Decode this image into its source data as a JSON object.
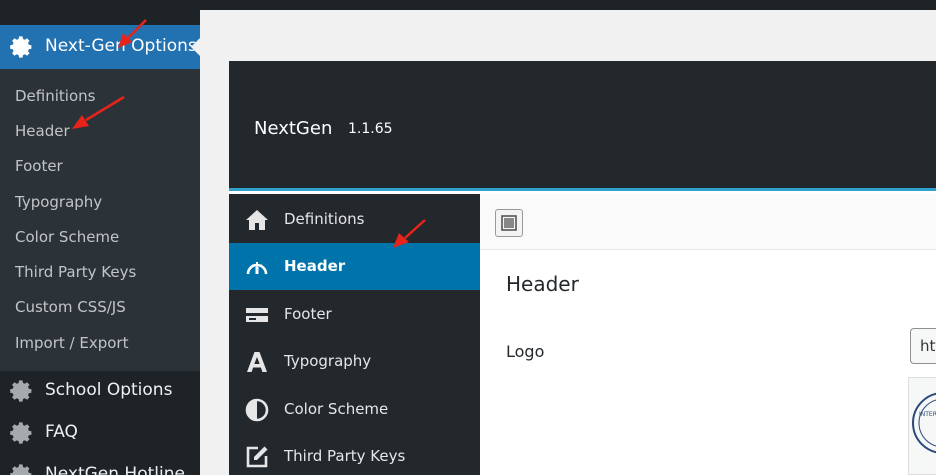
{
  "wp_menu": {
    "active_parent": "Next-Gen Options",
    "submenu": [
      "Definitions",
      "Header",
      "Footer",
      "Typography",
      "Color Scheme",
      "Third Party Keys",
      "Custom CSS/JS",
      "Import / Export"
    ],
    "other_items": [
      "School Options",
      "FAQ",
      "NextGen Hotline"
    ]
  },
  "panel": {
    "brand": "NextGen",
    "version": "1.1.65",
    "nav": [
      {
        "label": "Definitions",
        "icon": "home-icon"
      },
      {
        "label": "Header",
        "icon": "dashboard-icon",
        "active": true
      },
      {
        "label": "Footer",
        "icon": "footer-icon"
      },
      {
        "label": "Typography",
        "icon": "typography-icon"
      },
      {
        "label": "Color Scheme",
        "icon": "contrast-icon"
      },
      {
        "label": "Third Party Keys",
        "icon": "edit-icon"
      }
    ],
    "section_title": "Header",
    "field_label": "Logo",
    "logo_value": "htt"
  },
  "colors": {
    "admin_dark": "#1d2327",
    "submenu_bg": "#2c3338",
    "accent_blue": "#2271b1",
    "panel_active": "#0073aa",
    "panel_rule": "#2ea2cc",
    "annotation_red": "#e8241a"
  }
}
